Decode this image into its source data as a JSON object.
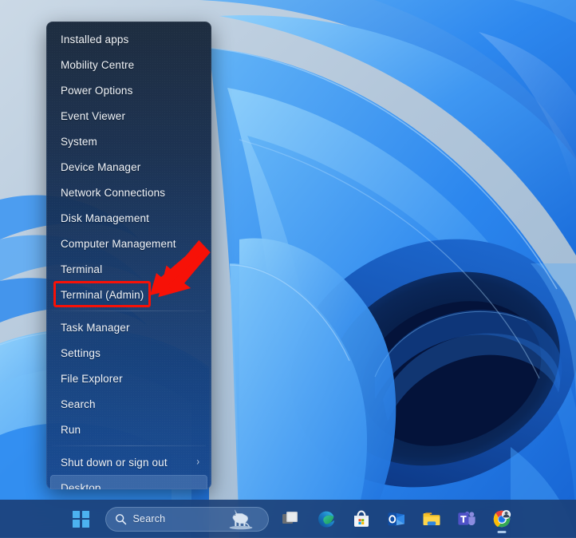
{
  "desktop": {
    "wallpaper_name": "windows-11-bloom-wallpaper",
    "colors": {
      "wallpaper_light": "#bdcfdf",
      "wallpaper_blue": "#1d7ff0",
      "wallpaper_deep": "#071c46",
      "menu_top": "#18273a",
      "menu_bottom": "#194a8e",
      "taskbar": "#1a3d74",
      "accent_red": "#f71107",
      "start_logo": "#4cb2f0"
    }
  },
  "winx_menu": {
    "name": "Windows X / Quick Link menu",
    "items": [
      {
        "label": "Installed apps",
        "selected": false,
        "submenu": false,
        "separator_after": false
      },
      {
        "label": "Mobility Centre",
        "selected": false,
        "submenu": false,
        "separator_after": false
      },
      {
        "label": "Power Options",
        "selected": false,
        "submenu": false,
        "separator_after": false
      },
      {
        "label": "Event Viewer",
        "selected": false,
        "submenu": false,
        "separator_after": false
      },
      {
        "label": "System",
        "selected": false,
        "submenu": false,
        "separator_after": false
      },
      {
        "label": "Device Manager",
        "selected": false,
        "submenu": false,
        "separator_after": false
      },
      {
        "label": "Network Connections",
        "selected": false,
        "submenu": false,
        "separator_after": false
      },
      {
        "label": "Disk Management",
        "selected": false,
        "submenu": false,
        "separator_after": false
      },
      {
        "label": "Computer Management",
        "selected": false,
        "submenu": false,
        "separator_after": false
      },
      {
        "label": "Terminal",
        "selected": false,
        "submenu": false,
        "separator_after": false
      },
      {
        "label": "Terminal (Admin)",
        "selected": false,
        "submenu": false,
        "separator_after": true
      },
      {
        "label": "Task Manager",
        "selected": false,
        "submenu": false,
        "separator_after": false
      },
      {
        "label": "Settings",
        "selected": false,
        "submenu": false,
        "separator_after": false
      },
      {
        "label": "File Explorer",
        "selected": false,
        "submenu": false,
        "separator_after": false
      },
      {
        "label": "Search",
        "selected": false,
        "submenu": false,
        "separator_after": false
      },
      {
        "label": "Run",
        "selected": false,
        "submenu": false,
        "separator_after": true
      },
      {
        "label": "Shut down or sign out",
        "selected": false,
        "submenu": true,
        "separator_after": false
      },
      {
        "label": "Desktop",
        "selected": true,
        "submenu": false,
        "separator_after": false
      }
    ],
    "submenu_chevron": "›"
  },
  "annotation": {
    "highlight_target": "Terminal (Admin)",
    "highlight_color": "#f71107",
    "arrow": "red-arrow-pointing-down-left"
  },
  "taskbar": {
    "start_button_label": "Start",
    "search": {
      "placeholder": "Search",
      "value": "",
      "icon": "search-icon",
      "decoration": "wolf-illustration"
    },
    "apps": [
      {
        "name": "Task View",
        "icon": "task-view-icon",
        "active": false
      },
      {
        "name": "Microsoft Edge",
        "icon": "edge-icon",
        "active": false
      },
      {
        "name": "Microsoft Store",
        "icon": "store-icon",
        "active": false
      },
      {
        "name": "Outlook",
        "icon": "outlook-icon",
        "active": false
      },
      {
        "name": "File Explorer",
        "icon": "file-explorer-icon",
        "active": false
      },
      {
        "name": "Microsoft Teams",
        "icon": "teams-icon",
        "active": false
      },
      {
        "name": "Google Chrome",
        "icon": "chrome-icon",
        "active": true
      }
    ]
  }
}
